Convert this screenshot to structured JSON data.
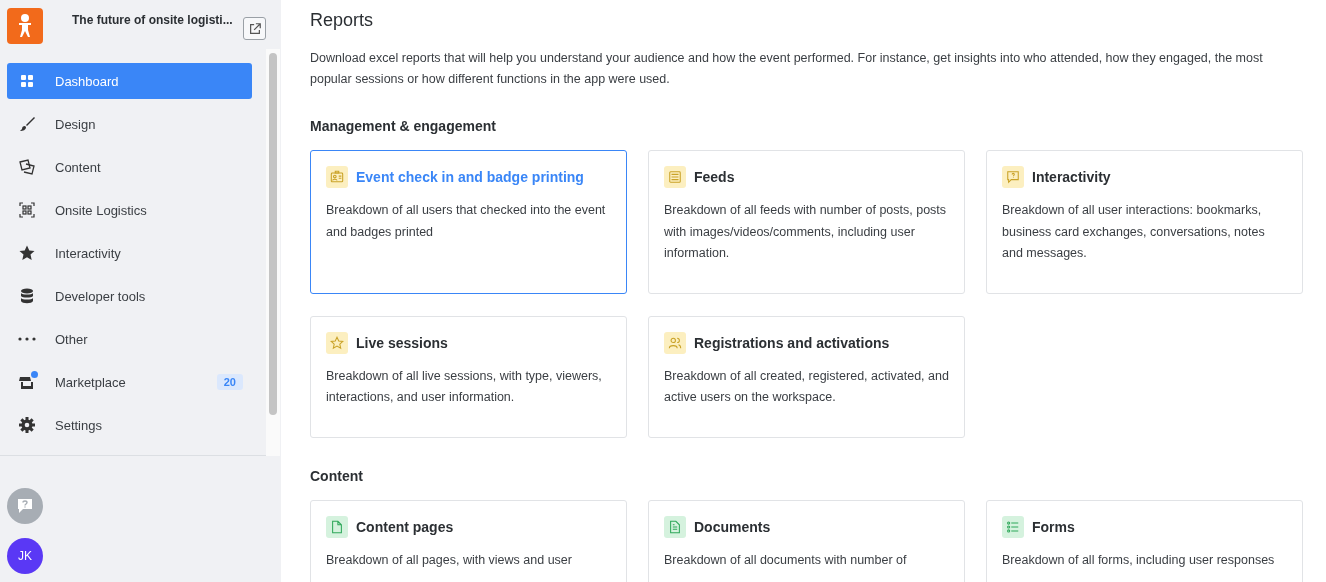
{
  "sidebar": {
    "event_title": "The future of onsite logisti...",
    "items": [
      {
        "label": "Dashboard",
        "selected": true
      },
      {
        "label": "Design",
        "selected": false
      },
      {
        "label": "Content",
        "selected": false
      },
      {
        "label": "Onsite Logistics",
        "selected": false
      },
      {
        "label": "Interactivity",
        "selected": false
      },
      {
        "label": "Developer tools",
        "selected": false
      },
      {
        "label": "Other",
        "selected": false
      },
      {
        "label": "Marketplace",
        "selected": false,
        "notification": true,
        "badge": "20"
      },
      {
        "label": "Settings",
        "selected": false
      }
    ],
    "avatar": "JK"
  },
  "page": {
    "title": "Reports",
    "description": "Download excel reports that will help you understand your audience and how the event performed. For instance, get insights into who attended, how they engaged, the most popular sessions or how different functions in the app were used.",
    "sections": [
      {
        "title": "Management & engagement",
        "cards": [
          {
            "title": "Event check in and badge printing",
            "selected": true,
            "text": "Breakdown of all users that checked into the event and badges printed"
          },
          {
            "title": "Feeds",
            "selected": false,
            "text": "Breakdown of all feeds with number of posts, posts with images/videos/comments, including user information."
          },
          {
            "title": "Interactivity",
            "selected": false,
            "text": "Breakdown of all user interactions: bookmarks, business card exchanges, conversations, notes and messages."
          },
          {
            "title": "Live sessions",
            "selected": false,
            "text": "Breakdown of all live sessions, with type, viewers, interactions, and user information."
          },
          {
            "title": "Registrations and activations",
            "selected": false,
            "text": "Breakdown of all created, registered, activated, and active users on the workspace."
          }
        ]
      },
      {
        "title": "Content",
        "cards": [
          {
            "title": "Content pages",
            "selected": false,
            "text": "Breakdown of all pages, with views and user"
          },
          {
            "title": "Documents",
            "selected": false,
            "text": "Breakdown of all documents with number of"
          },
          {
            "title": "Forms",
            "selected": false,
            "text": "Breakdown of all forms, including user responses"
          }
        ]
      }
    ]
  }
}
